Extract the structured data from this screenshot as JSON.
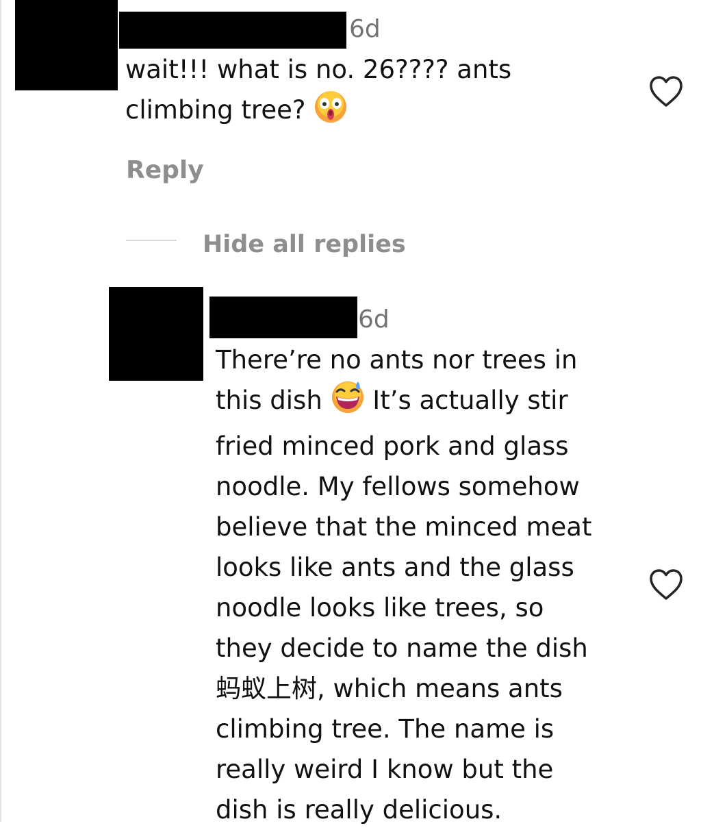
{
  "comment": {
    "timestamp": "6d",
    "text_line1": "wait!!! what is no. 26???? ants",
    "text_line2": "climbing tree? ",
    "emoji": "face-screaming-in-fear-emoji",
    "reply_label": "Reply",
    "like_icon": "heart-outline-icon"
  },
  "replies": {
    "hide_label": "Hide all replies"
  },
  "reply": {
    "timestamp": "6d",
    "lines": {
      "l1": "There’re no ants nor trees in",
      "l2a": "this dish ",
      "l2b": " It’s actually stir",
      "l3": "fried minced pork and glass",
      "l4": "noodle. My fellows somehow",
      "l5": "believe that the minced meat",
      "l6": "looks like ants and the glass",
      "l7": "noodle looks like trees, so",
      "l8": "they decide to name the dish",
      "l9": "蚂蚁上树, which means ants",
      "l10": "climbing tree. The name is",
      "l11": "really weird I know but the",
      "l12": "dish is really delicious."
    },
    "emoji": "grinning-face-with-sweat-emoji",
    "like_icon": "heart-outline-icon"
  }
}
